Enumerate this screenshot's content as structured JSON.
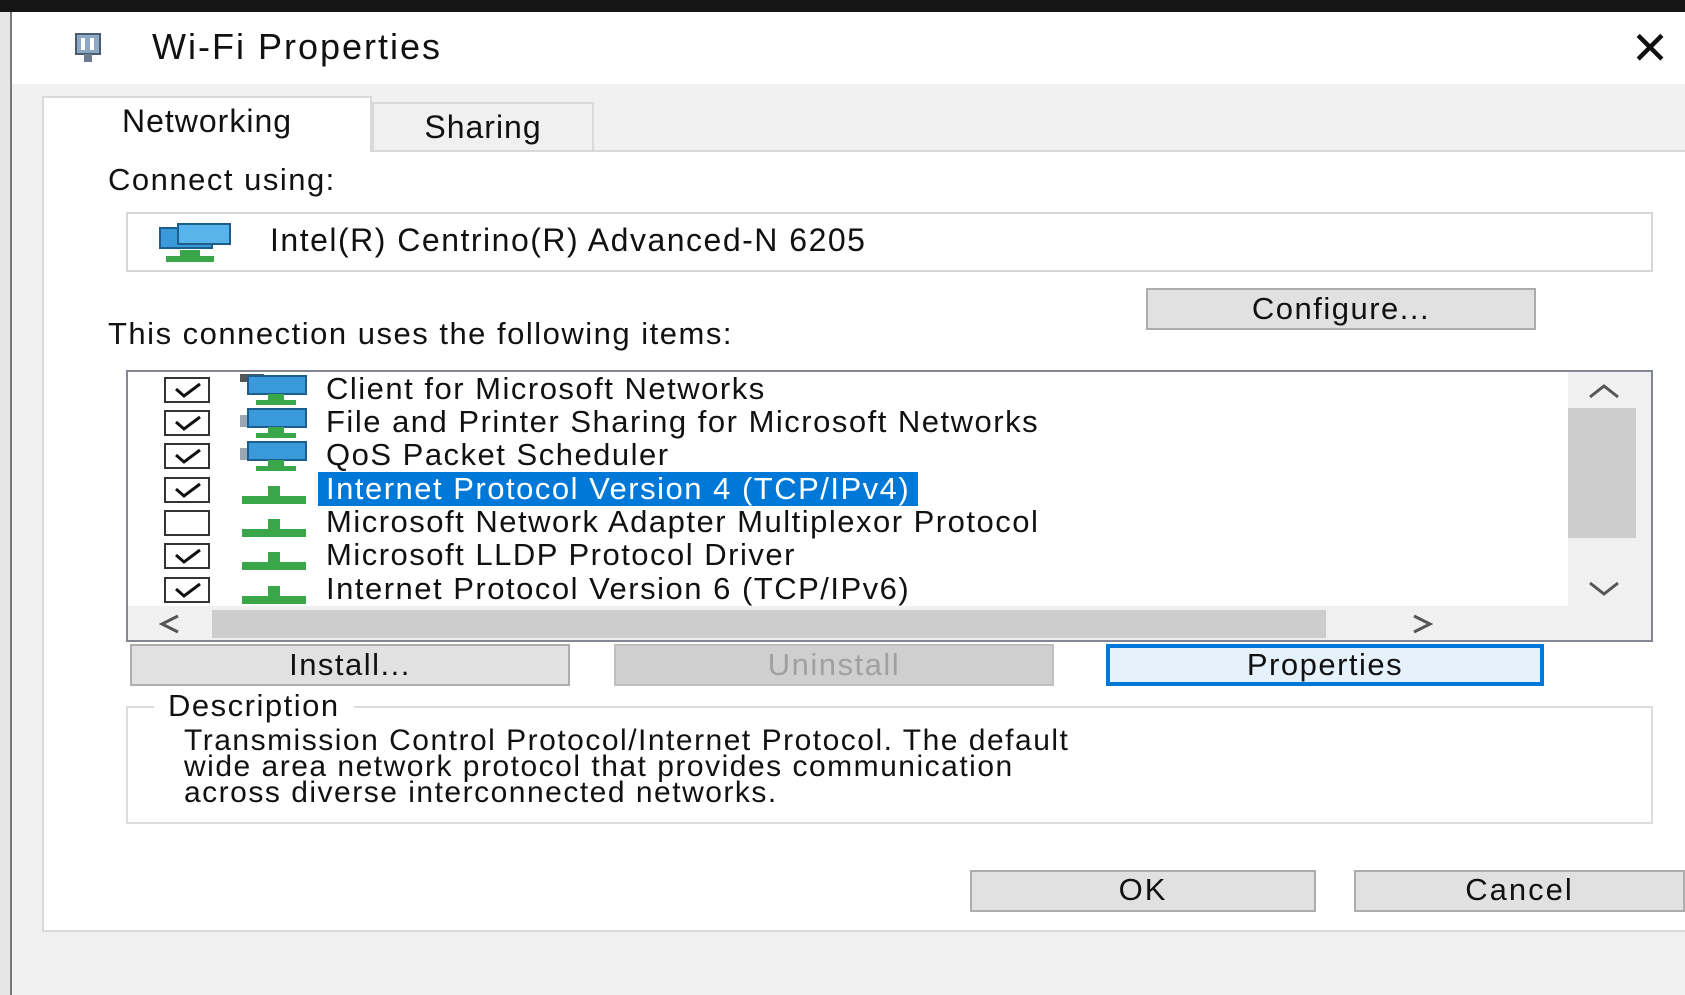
{
  "window": {
    "title": "Wi-Fi Properties",
    "close_glyph": "✕",
    "icon": "network-adapter-icon"
  },
  "tabs": [
    {
      "label": "Networking",
      "active": true
    },
    {
      "label": "Sharing",
      "active": false
    }
  ],
  "networking": {
    "connect_using_label": "Connect using:",
    "adapter_name": "Intel(R) Centrino(R) Advanced-N 6205",
    "configure_label": "Configure...",
    "items_label": "This connection uses the following items:",
    "items": [
      {
        "label": "Client for Microsoft Networks",
        "checked": true,
        "selected": false,
        "icon": "client-network-icon"
      },
      {
        "label": "File and Printer Sharing for Microsoft Networks",
        "checked": true,
        "selected": false,
        "icon": "service-network-icon"
      },
      {
        "label": "QoS Packet Scheduler",
        "checked": true,
        "selected": false,
        "icon": "service-network-icon"
      },
      {
        "label": "Internet Protocol Version 4 (TCP/IPv4)",
        "checked": true,
        "selected": true,
        "icon": "protocol-icon"
      },
      {
        "label": "Microsoft Network Adapter Multiplexor Protocol",
        "checked": false,
        "selected": false,
        "icon": "protocol-icon"
      },
      {
        "label": "Microsoft LLDP Protocol Driver",
        "checked": true,
        "selected": false,
        "icon": "protocol-icon"
      },
      {
        "label": "Internet Protocol Version 6 (TCP/IPv6)",
        "checked": true,
        "selected": false,
        "icon": "protocol-icon"
      }
    ],
    "install_label": "Install...",
    "uninstall_label": "Uninstall",
    "properties_label": "Properties",
    "description_legend": "Description",
    "description_lines": [
      "Transmission Control Protocol/Internet Protocol. The default",
      "wide area network protocol that provides communication",
      "across diverse interconnected networks."
    ]
  },
  "footer": {
    "ok_label": "OK",
    "cancel_label": "Cancel"
  },
  "colors": {
    "selection": "#0078d7",
    "focus_border": "#0078d7",
    "button_face": "#e1e1e1",
    "dialog_bg": "#f0f0f0"
  }
}
